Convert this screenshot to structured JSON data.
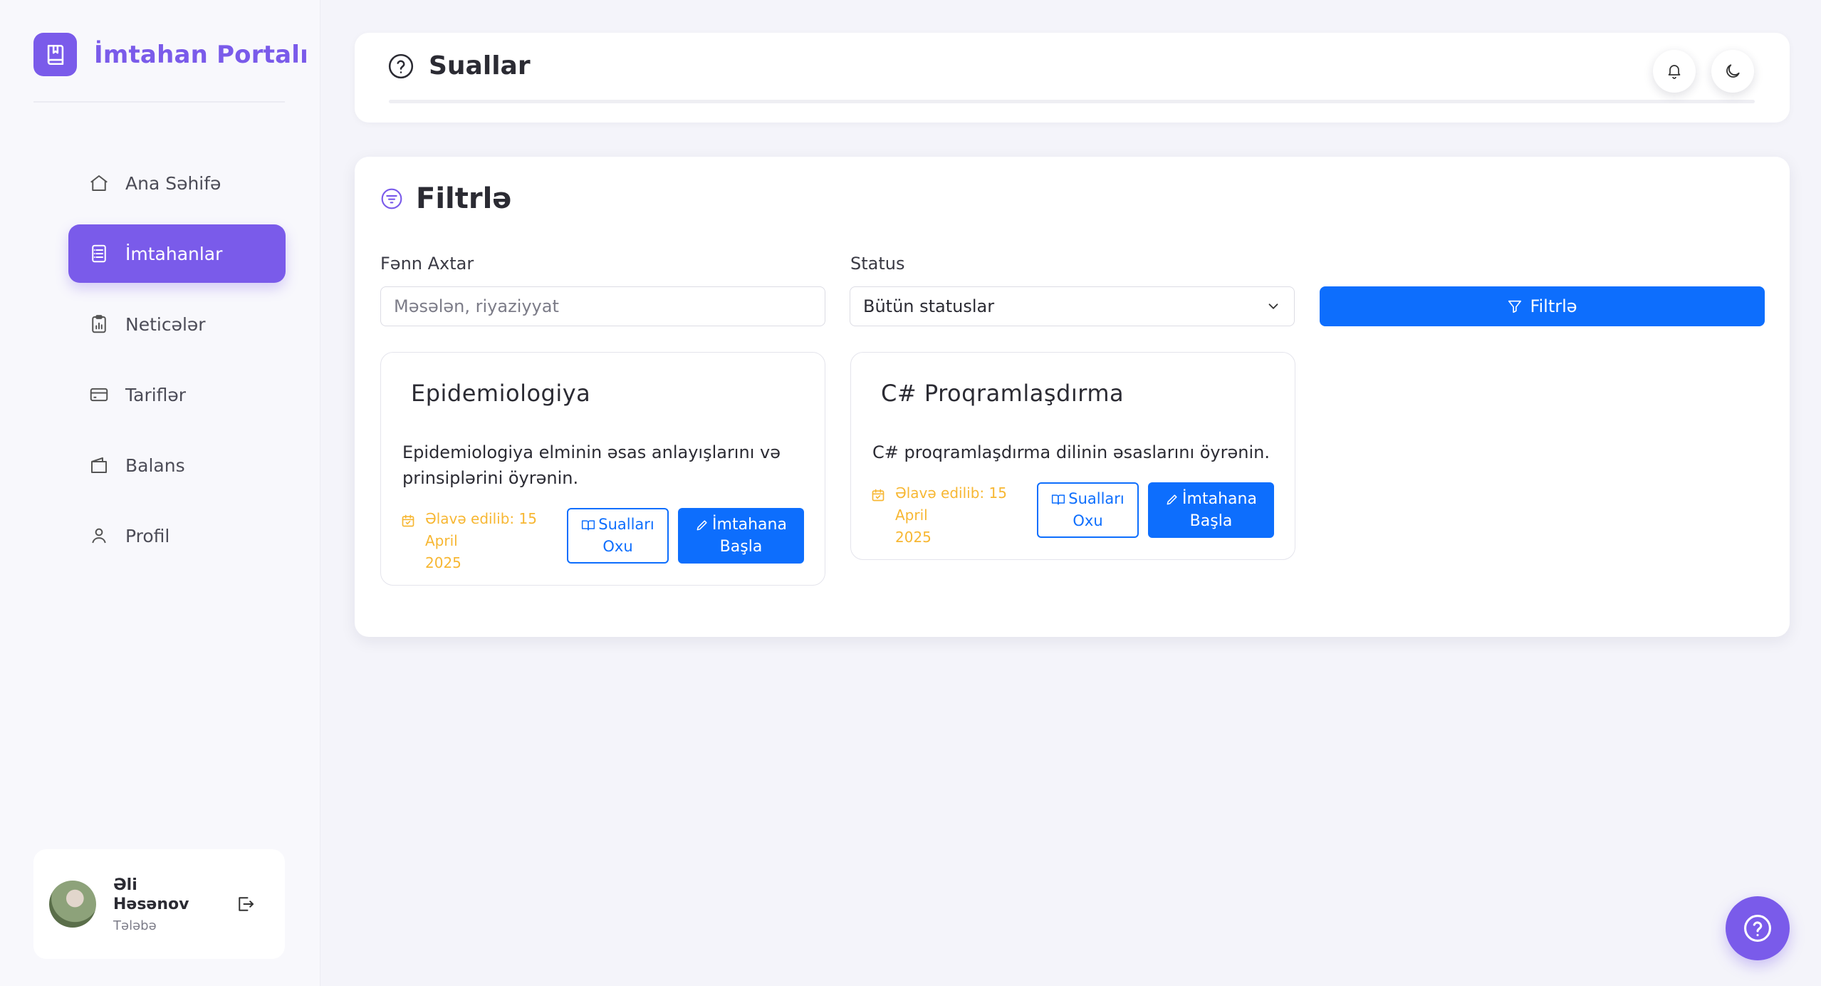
{
  "brand": {
    "title": "İmtahan Portalı",
    "logo_icon": "exam-book-icon"
  },
  "sidebar": {
    "items": [
      {
        "label": "Ana Səhifə",
        "icon": "home-icon",
        "active": false
      },
      {
        "label": "İmtahanlar",
        "icon": "exam-list-icon",
        "active": true
      },
      {
        "label": "Neticələr",
        "icon": "clipboard-chart-icon",
        "active": false
      },
      {
        "label": "Tariflər",
        "icon": "credit-card-icon",
        "active": false
      },
      {
        "label": "Balans",
        "icon": "wallet-icon",
        "active": false
      },
      {
        "label": "Profil",
        "icon": "user-icon",
        "active": false
      }
    ]
  },
  "user": {
    "first_name": "Əli",
    "last_name": "Həsənov",
    "role": "Tələbə"
  },
  "header": {
    "title": "Suallar",
    "title_icon": "question-circle-icon"
  },
  "filter": {
    "title": "Filtrlə",
    "search_label": "Fənn Axtar",
    "search_placeholder": "Məsələn, riyaziyyat",
    "search_value": "",
    "status_label": "Status",
    "status_selected": "Bütün statuslar",
    "button_label": "Filtrlə"
  },
  "exams": [
    {
      "title": "Epidemiologiya",
      "description": "Epidemiologiya elminin əsas anlayışlarını və prinsiplərini öyrənin.",
      "date_line1": "Əlavə edilib: 15 April",
      "date_line2": "2025",
      "read_line1": "Sualları",
      "read_line2": "Oxu",
      "start_line1": "İmtahana",
      "start_line2": "Başla"
    },
    {
      "title": "C# Proqramlaşdırma",
      "description": "C# proqramlaşdırma dilinin əsaslarını öyrənin.",
      "date_line1": "Əlavə edilib: 15 April",
      "date_line2": "2025",
      "read_line1": "Sualları",
      "read_line2": "Oxu",
      "start_line1": "İmtahana",
      "start_line2": "Başla"
    }
  ],
  "colors": {
    "accent": "#7a5bea",
    "primary_button": "#0d6efd",
    "date_text": "#f7b733"
  }
}
